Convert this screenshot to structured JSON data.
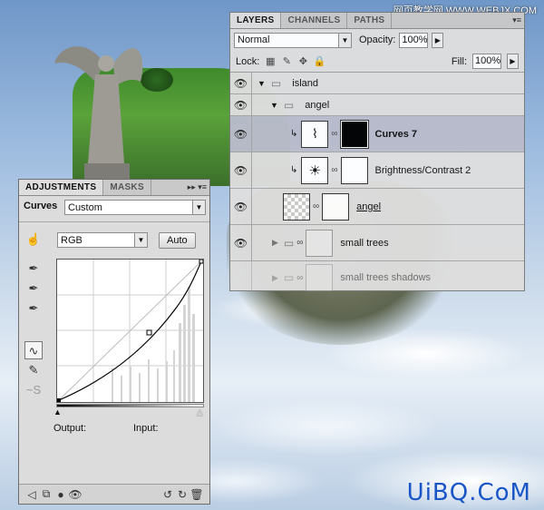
{
  "watermarks": {
    "top": "网页教学网 WWW.WEBJX.COM",
    "bottom": "UiBQ.CoM"
  },
  "layers_panel": {
    "tabs": [
      "LAYERS",
      "CHANNELS",
      "PATHS"
    ],
    "blend_mode": "Normal",
    "opacity_label": "Opacity:",
    "opacity_value": "100%",
    "lock_label": "Lock:",
    "fill_label": "Fill:",
    "fill_value": "100%",
    "layers": [
      {
        "name": "island",
        "type": "group",
        "expanded": true
      },
      {
        "name": "angel",
        "type": "group",
        "expanded": true
      },
      {
        "name": "Curves 7",
        "type": "adjustment",
        "selected": true,
        "icon": "curves-icon"
      },
      {
        "name": "Brightness/Contrast 2",
        "type": "adjustment",
        "icon": "brightness-icon"
      },
      {
        "name": "angel",
        "type": "layer"
      },
      {
        "name": "small trees",
        "type": "group",
        "expanded": false
      },
      {
        "name": "small trees shadows",
        "type": "group",
        "expanded": false
      }
    ]
  },
  "adjustments_panel": {
    "tabs": [
      "ADJUSTMENTS",
      "MASKS"
    ],
    "title": "Curves",
    "preset": "Custom",
    "channel": "RGB",
    "auto_label": "Auto",
    "output_label": "Output:",
    "input_label": "Input:"
  }
}
